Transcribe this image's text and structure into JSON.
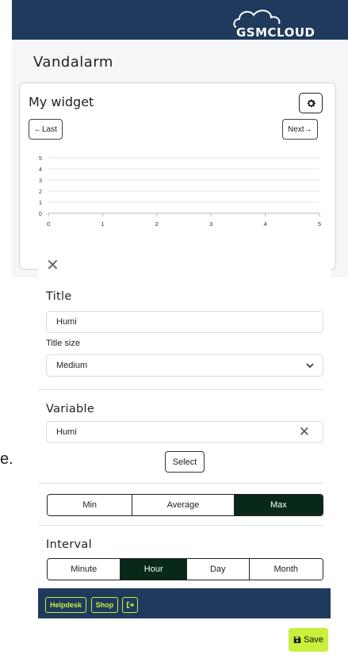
{
  "header": {
    "logo_text": "GSMCLOUD"
  },
  "page": {
    "title": "Vandalarm"
  },
  "widget": {
    "title": "My widget",
    "prev_label": "←Last",
    "next_label": "Next→"
  },
  "chart_data": {
    "type": "line",
    "x_ticks": [
      "0",
      "1",
      "2",
      "3",
      "4",
      "5"
    ],
    "y_ticks": [
      "0",
      "1",
      "2",
      "3",
      "4",
      "5"
    ],
    "xlim": [
      0,
      5
    ],
    "ylim": [
      0,
      5
    ],
    "series": [],
    "grid": true
  },
  "panel": {
    "title_section": "Title",
    "title_value": "Humi",
    "title_size_label": "Title size",
    "title_size_value": "Medium",
    "variable_section": "Variable",
    "variable_value": "Humi",
    "select_label": "Select",
    "aggregations": [
      {
        "label": "Min",
        "active": false
      },
      {
        "label": "Average",
        "active": false
      },
      {
        "label": "Max",
        "active": true
      }
    ],
    "interval_section": "Interval",
    "intervals": [
      {
        "label": "Minute",
        "active": false
      },
      {
        "label": "Hour",
        "active": true
      },
      {
        "label": "Day",
        "active": false
      },
      {
        "label": "Month",
        "active": false
      }
    ]
  },
  "footer": {
    "helpdesk_label": "Helpdesk",
    "shop_label": "Shop"
  },
  "save_label": "Save",
  "stray_text": "e.",
  "colors": {
    "header_bg": "#1f3a5c",
    "accent": "#c8f03c",
    "active_segment": "#082818"
  }
}
